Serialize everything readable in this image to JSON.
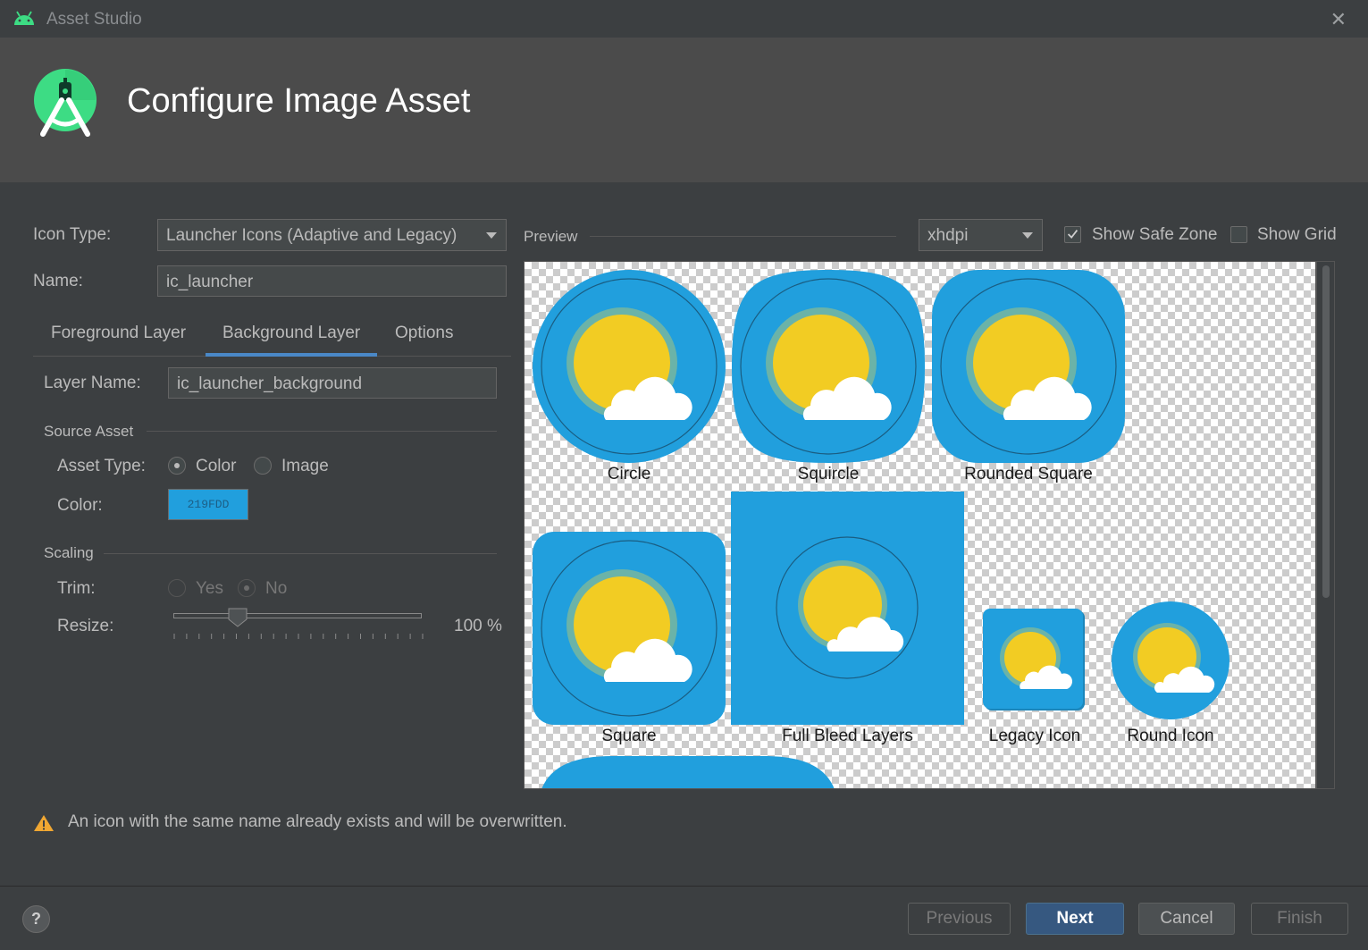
{
  "window": {
    "title": "Asset Studio",
    "close_glyph": "✕"
  },
  "header": {
    "title": "Configure Image Asset",
    "logo_icon": "android-studio-logo-icon"
  },
  "form": {
    "icon_type_label": "Icon Type:",
    "icon_type_value": "Launcher Icons (Adaptive and Legacy)",
    "name_label": "Name:",
    "name_value": "ic_launcher"
  },
  "tabs": [
    {
      "label": "Foreground Layer",
      "selected": false
    },
    {
      "label": "Background Layer",
      "selected": true
    },
    {
      "label": "Options",
      "selected": false
    }
  ],
  "layer": {
    "layer_name_label": "Layer Name:",
    "layer_name_value": "ic_launcher_background",
    "source_asset_title": "Source Asset",
    "asset_type_label": "Asset Type:",
    "asset_type_options": [
      "Color",
      "Image"
    ],
    "asset_type_selected": "Color",
    "color_label": "Color:",
    "color_value": "219FDD",
    "color_hex": "#219fdd",
    "scaling_title": "Scaling",
    "trim_label": "Trim:",
    "trim_options": [
      "Yes",
      "No"
    ],
    "trim_selected": "No",
    "resize_label": "Resize:",
    "resize_value_text": "100 %",
    "resize_fraction": 0.25
  },
  "preview": {
    "title": "Preview",
    "density_value": "xhdpi",
    "show_safe_zone_label": "Show Safe Zone",
    "show_safe_zone_checked": true,
    "show_grid_label": "Show Grid",
    "show_grid_checked": false,
    "icons": [
      "Circle",
      "Squircle",
      "Rounded Square",
      "Square",
      "Full Bleed Layers",
      "Legacy Icon",
      "Round Icon"
    ]
  },
  "warning": {
    "text": "An icon with the same name already exists and will be overwritten.",
    "icon": "warning-triangle-icon"
  },
  "footer": {
    "help": "?",
    "previous": "Previous",
    "next": "Next",
    "cancel": "Cancel",
    "finish": "Finish"
  },
  "colors": {
    "accent": "#4a88c7",
    "icon_bg": "#219fdd",
    "sun": "#f2cc23",
    "primary_button": "#365880"
  }
}
